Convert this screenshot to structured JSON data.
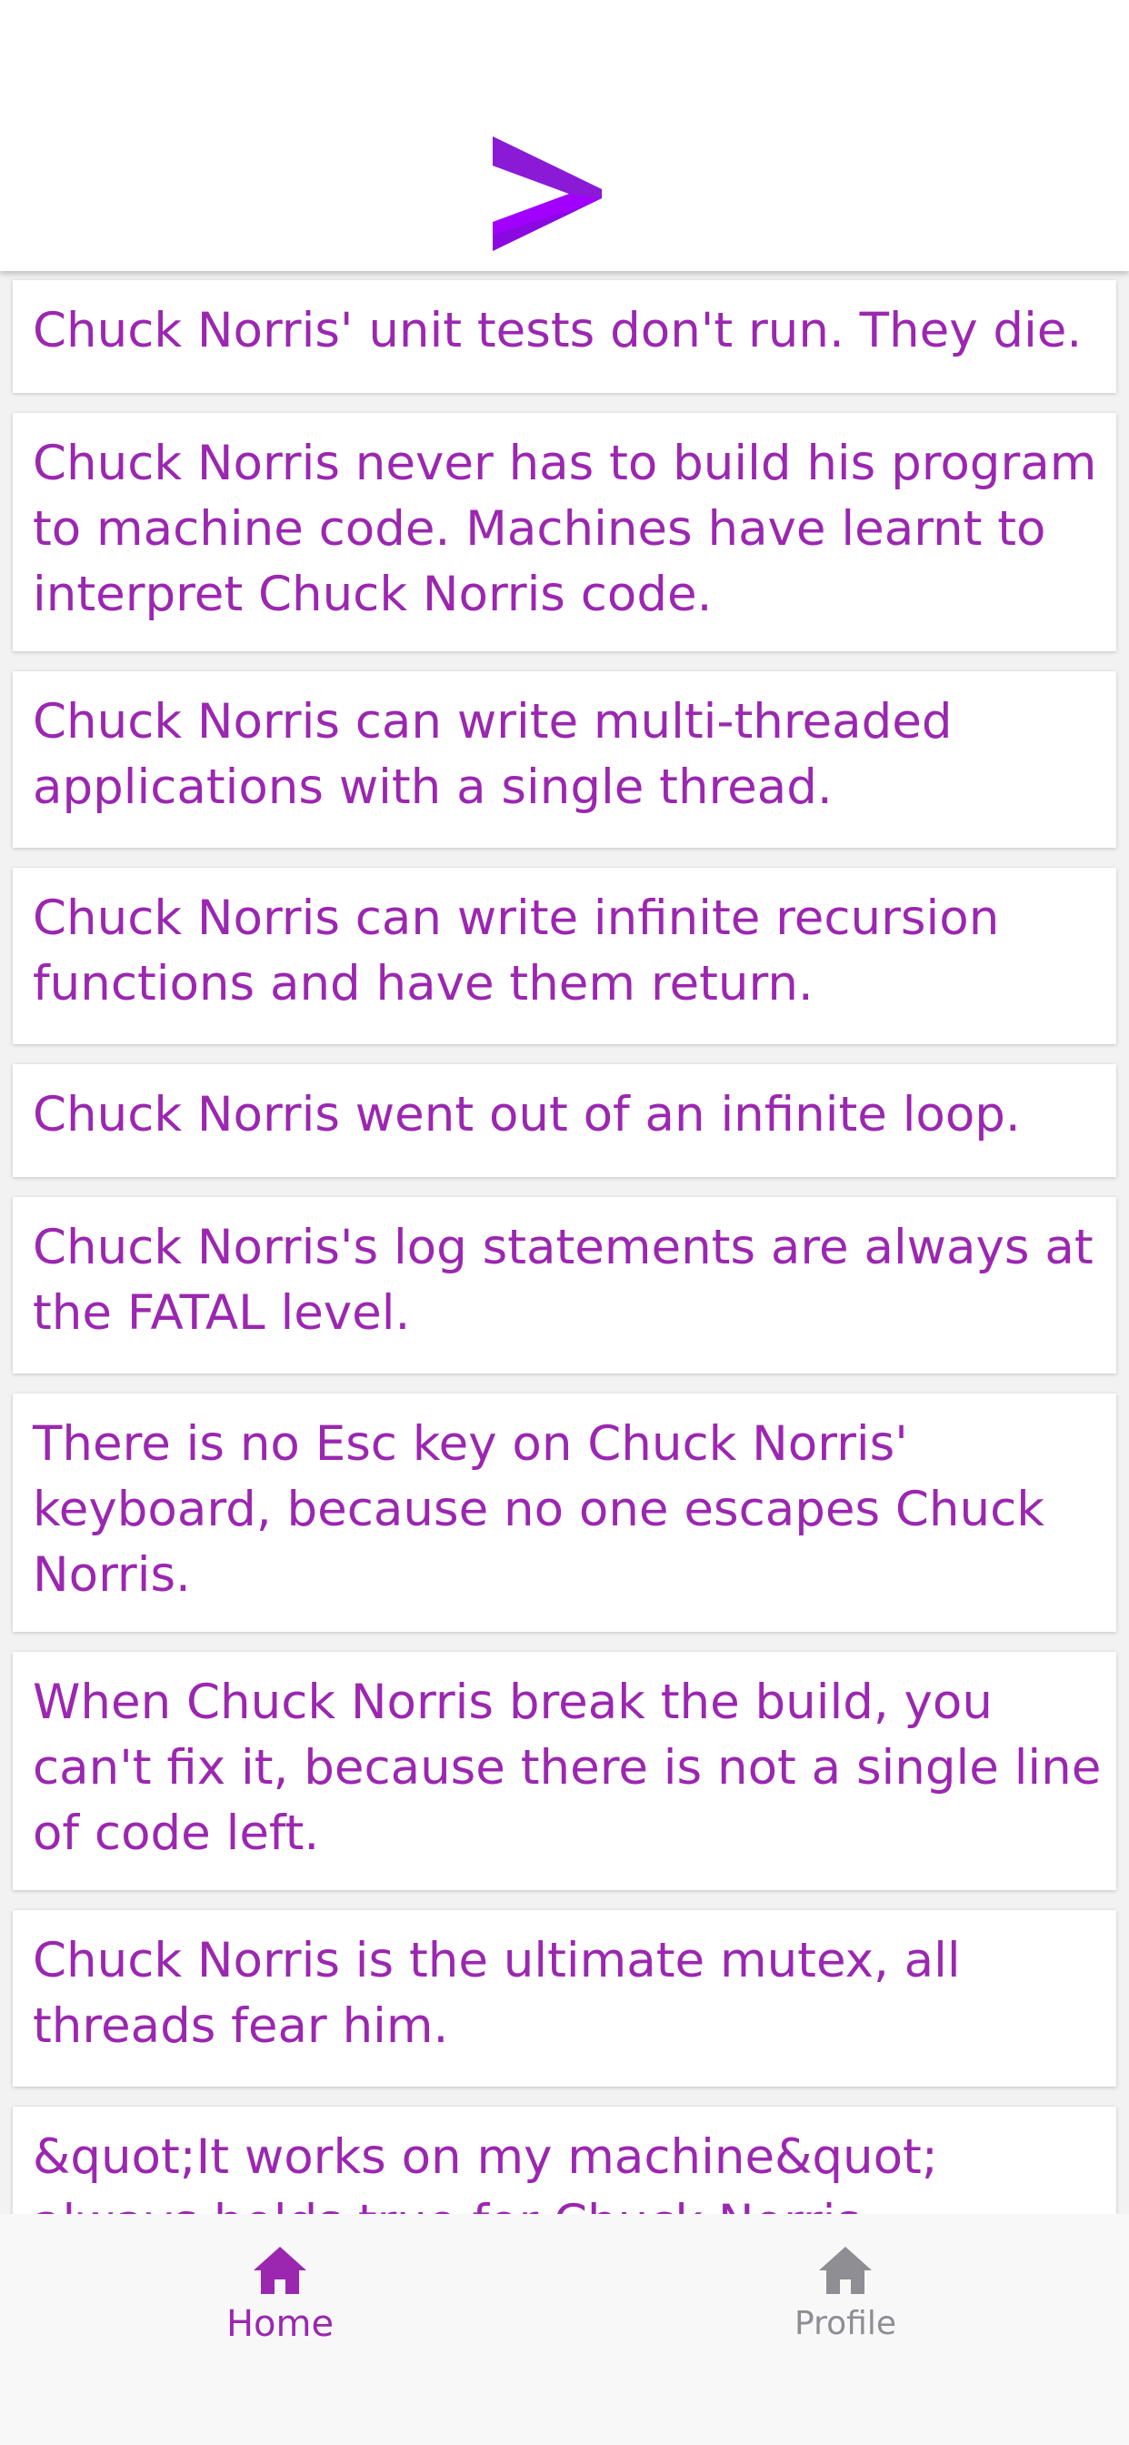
{
  "header": {
    "logo_icon": "accenture-chevron-logo",
    "logo_color": "#a100ff"
  },
  "jokes": [
    "Chuck Norris' unit tests don't run. They die.",
    "Chuck Norris never has to build his program to machine code. Machines have learnt to interpret Chuck Norris code.",
    "Chuck Norris can write multi-threaded applications with a single thread.",
    "Chuck Norris can write infinite recursion functions and have them return.",
    "Chuck Norris went out of an infinite loop.",
    "Chuck Norris's log statements are always at the FATAL level.",
    "There is no Esc key on Chuck Norris' keyboard, because no one escapes Chuck Norris.",
    "When Chuck Norris break the build, you can't fix it, because there is not a single line of code left.",
    "Chuck Norris is the ultimate mutex, all threads fear him.",
    "&quot;It works on my machine&quot; always holds true for Chuck Norris."
  ],
  "tabbar": {
    "home_label": "Home",
    "home_icon": "home-icon",
    "profile_label": "Profile",
    "profile_icon": "home-icon",
    "active_color": "#9b27b0",
    "inactive_color": "#8e8e93"
  },
  "colors": {
    "text": "#9b27b0",
    "background": "#f2f2f2",
    "card": "#ffffff"
  }
}
